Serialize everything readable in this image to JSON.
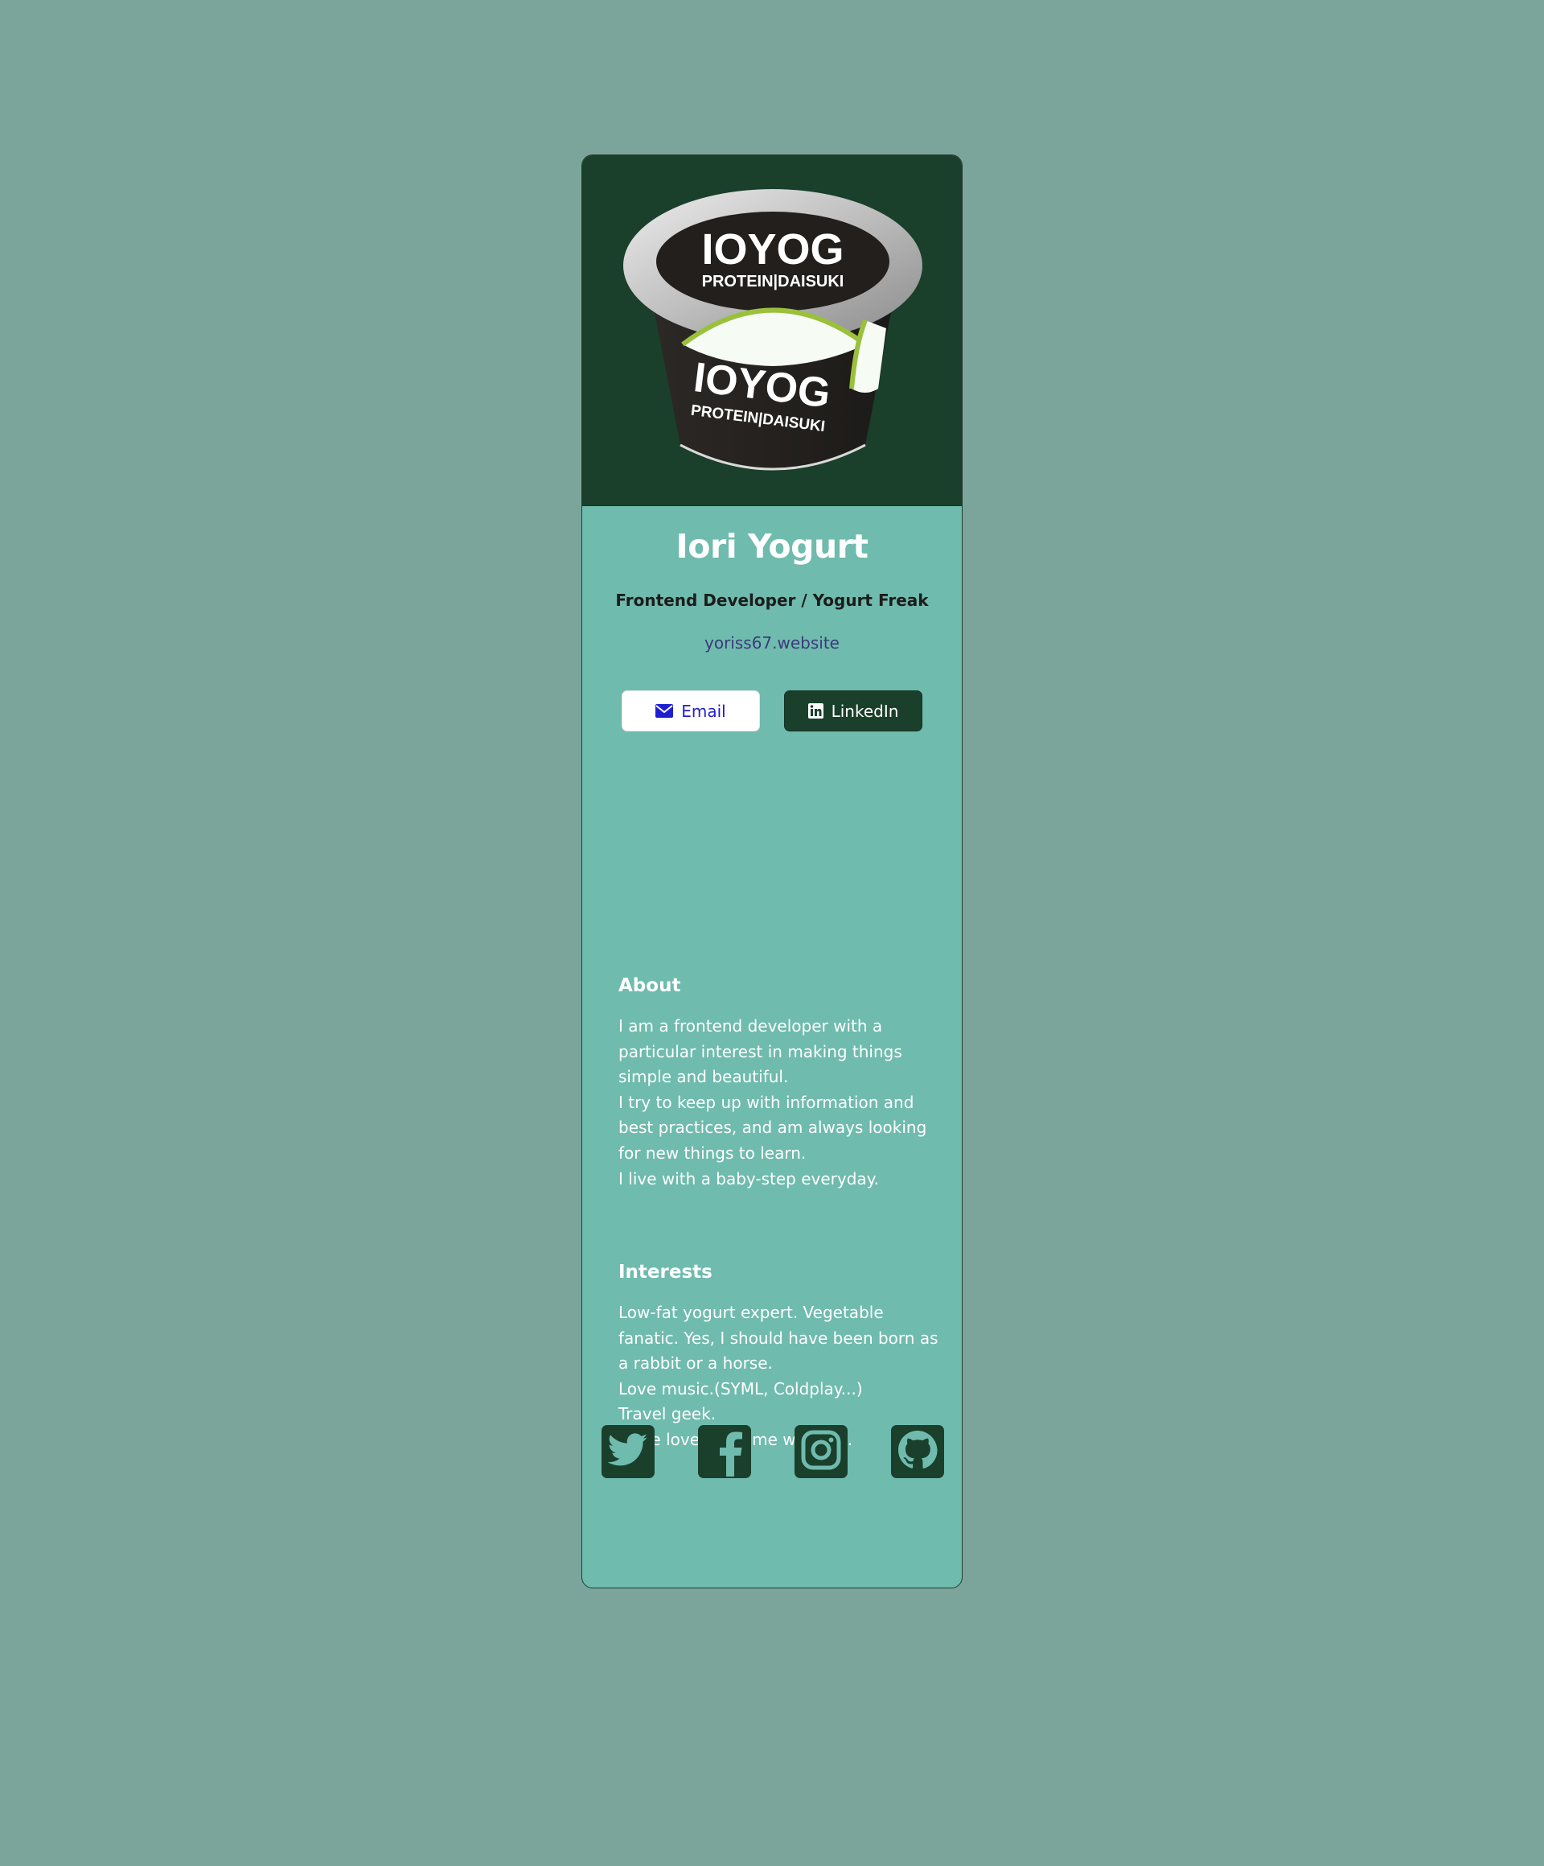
{
  "colors": {
    "page_background": "#7ba59b",
    "card_background": "#6fbbae",
    "hero_background": "#1a3f2b",
    "accent_dark": "#1a3f2b",
    "email_text": "#1f1fd1",
    "website_link": "#3b3a7a"
  },
  "hero": {
    "logo_brand": "IOYOG",
    "logo_tagline": "PROTEIN|DAISUKI"
  },
  "profile": {
    "name": "Iori Yogurt",
    "role": "Frontend Developer / Yogurt Freak",
    "website": "yoriss67.website"
  },
  "buttons": {
    "email": {
      "label": "Email",
      "icon": "envelope-icon"
    },
    "linkedin": {
      "label": "LinkedIn",
      "icon": "linkedin-icon"
    }
  },
  "about": {
    "title": "About",
    "text": "I am a frontend developer with a particular interest in making things simple and beautiful.\nI try to keep up with information and best practices, and am always looking for new things to learn.\nI live with a baby-step everyday."
  },
  "interests": {
    "title": "Interests",
    "text": "Low-fat yogurt expert. Vegetable fanatic. Yes, I should have been born as a rabbit or a horse.\nLove music.(SYML, Coldplay...)\nTravel geek.\nHuge lover of home workout."
  },
  "social": [
    {
      "icon": "twitter-icon"
    },
    {
      "icon": "facebook-icon"
    },
    {
      "icon": "instagram-icon"
    },
    {
      "icon": "github-icon"
    }
  ]
}
